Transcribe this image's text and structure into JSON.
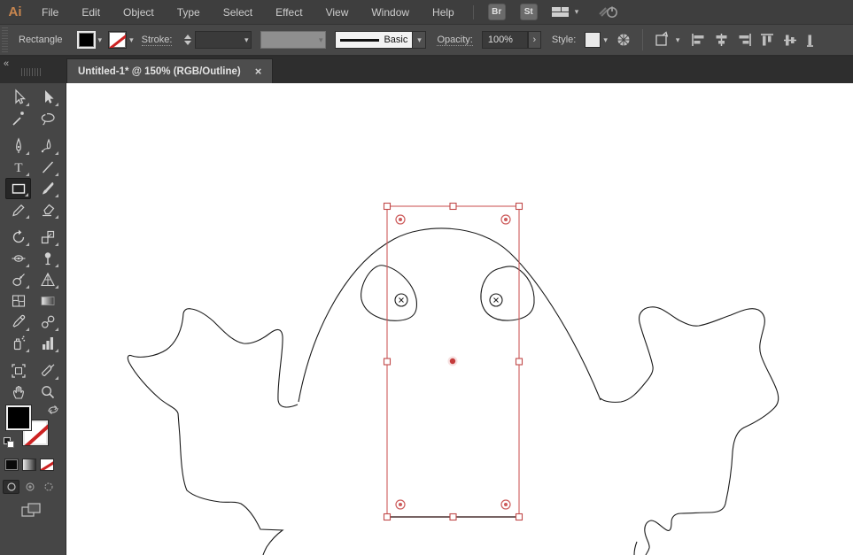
{
  "app": {
    "logo_text": "Ai"
  },
  "menubar": {
    "items": [
      "File",
      "Edit",
      "Object",
      "Type",
      "Select",
      "Effect",
      "View",
      "Window",
      "Help"
    ],
    "bridge_button": "Br",
    "stock_button": "St"
  },
  "controlbar": {
    "selection_label": "Rectangle",
    "stroke_label": "Stroke:",
    "brush_definition": "Basic",
    "opacity_label": "Opacity:",
    "opacity_value": "100%",
    "opacity_expand": "›",
    "style_label": "Style:"
  },
  "tabbar": {
    "collapse_icon": "«",
    "tab_title": "Untitled-1* @ 150% (RGB/Outline)",
    "close_label": "×"
  },
  "toolbar": {
    "tools": [
      "selection",
      "direct-selection",
      "magic-wand",
      "lasso",
      "pen",
      "curvature",
      "type",
      "line-segment",
      "rectangle",
      "paintbrush",
      "pencil",
      "eraser",
      "rotate",
      "scale",
      "width",
      "free-transform",
      "shape-builder",
      "perspective-grid",
      "mesh",
      "gradient",
      "eyedropper",
      "blend",
      "symbol-sprayer",
      "column-graph",
      "artboard",
      "slice",
      "hand",
      "zoom"
    ],
    "selected_tool": "rectangle"
  },
  "canvas": {
    "document_mode": "Outline",
    "selection_color": "#cd5b5b",
    "center_dot_color": "#c43b3b",
    "artwork_stroke_color": "#000000"
  },
  "colors": {
    "ui_dark": "#3e3e3e",
    "ui_mid": "#474747",
    "logo_orange": "#c8864f",
    "canvas_white": "#ffffff",
    "accent_red": "#cd5b5b"
  }
}
